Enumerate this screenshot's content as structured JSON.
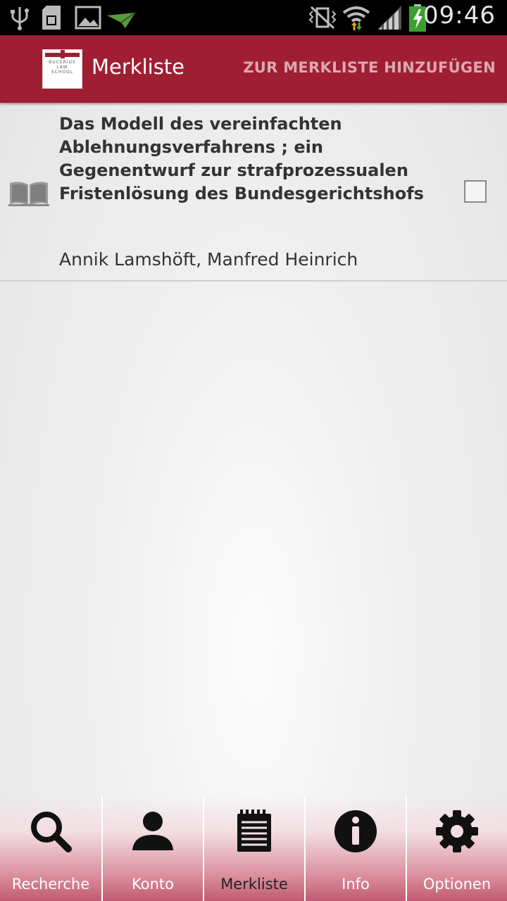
{
  "status_bar": {
    "time": "09:46",
    "icons": [
      "usb-icon",
      "sd-card-icon",
      "image-icon",
      "paper-plane-icon",
      "vibrate-icon",
      "wifi-icon",
      "signal-icon",
      "battery-charging-icon"
    ]
  },
  "action_bar": {
    "logo_text": "BUCERIUS LAW SCHOOL",
    "title": "Merkliste",
    "action_label": "ZUR MERKLISTE HINZUFÜGEN",
    "color": "#a01e32"
  },
  "list": {
    "items": [
      {
        "icon": "book-icon",
        "title": "Das Modell des vereinfachten Ablehnungsverfahrens ; ein Gegenentwurf zur strafprozessualen Fristenlösung des Bundesgerichtshofs",
        "authors": "Annik Lamshöft, Manfred Heinrich",
        "checked": false
      }
    ]
  },
  "tabs": [
    {
      "label": "Recherche",
      "icon": "search-icon"
    },
    {
      "label": "Konto",
      "icon": "user-icon"
    },
    {
      "label": "Merkliste",
      "icon": "notepad-icon",
      "active": true
    },
    {
      "label": "Info",
      "icon": "info-icon"
    },
    {
      "label": "Optionen",
      "icon": "gear-icon"
    }
  ]
}
